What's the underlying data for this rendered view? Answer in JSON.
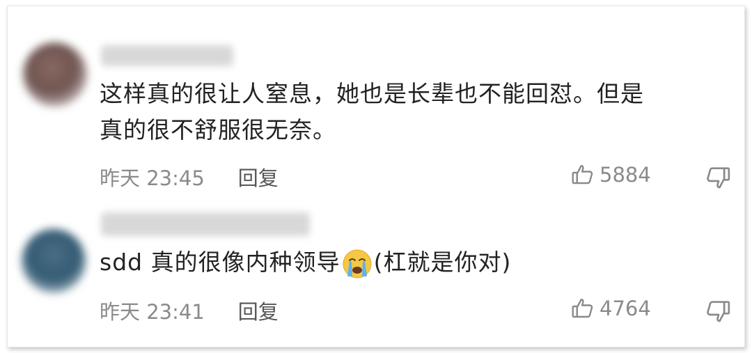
{
  "comments": [
    {
      "text": "这样真的很让人窒息，她也是长辈也不能回怼。但是\n真的很不舒服很无奈。",
      "time": "昨天 23:45",
      "reply_label": "回复",
      "likes": "5884",
      "avatar_icon": "avatar-blurred",
      "like_icon": "thumbs-up-outline-icon",
      "dislike_icon": "thumbs-down-outline-icon"
    },
    {
      "text_before": "sdd 真的很像内种领导",
      "emoji": "crying-face-emoji",
      "text_after": "(杠就是你对)",
      "time": "昨天 23:41",
      "reply_label": "回复",
      "likes": "4764",
      "avatar_icon": "avatar-blurred",
      "like_icon": "thumbs-up-outline-icon",
      "dislike_icon": "thumbs-down-outline-icon"
    }
  ],
  "colors": {
    "text": "#222222",
    "meta": "#8a8a8a",
    "reply": "#555555"
  }
}
